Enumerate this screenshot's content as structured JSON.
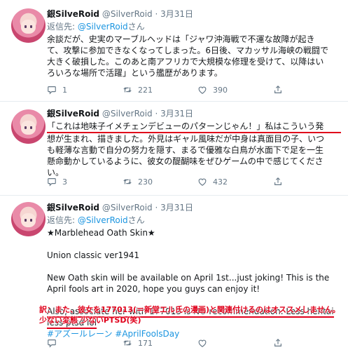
{
  "tweets": [
    {
      "name": "銀SilveRoid",
      "handle": "@SilverRoid",
      "dot": "·",
      "date": "3月31日",
      "replying_prefix": "返信先: ",
      "replying_to": "@SilverRoid",
      "replying_suffix": "さん",
      "lines": [
        "余談だが、史実のマーブルヘッドは「ジャワ沖海戦で不運な故障が起き",
        "て、攻撃に参加できなくなってしまった。6日後、マカッサル海峡の戦闘で",
        "大きく破損した。このあと南アフリカで大規模な修理を受けて、以降はい",
        "ろいろな場所で活躍」という艦歴があります。"
      ],
      "replies": "1",
      "retweets": "221",
      "likes": "390"
    },
    {
      "name": "銀SilveRoid",
      "handle": "@SilverRoid",
      "dot": "·",
      "date": "3月31日",
      "lines": [
        "「これは地味子イメチェンデビューのパターンじゃん！」私はこういう発",
        "想が生まれ、描きました。外見はギャル風味だが中身は真面目の子、いつ",
        "も軽薄な言動で自分の努力を隠す、まるで優雅な白鳥が水面下で足を一生",
        "懸命動かしているように、彼女の醍醐味をぜひゲームの中で感じてくださ",
        "い。"
      ],
      "replies": "3",
      "retweets": "230",
      "likes": "432"
    },
    {
      "name": "銀SilveRoid",
      "handle": "@SilverRoid",
      "dot": "·",
      "date": "3月31日",
      "replying_prefix": "返信先: ",
      "replying_to": "@SilverRoid",
      "replying_suffix": "さん",
      "title": "★Marblehead Oath Skin★",
      "subtitle": "Union classic ver1941",
      "para1": "New Oath skin will be available on April 1st...just joking! This is the April fools art in 2020, hope you guys can enjoy it!",
      "para2": "Also, associate her with 177013 is NO recommendation. Less hentai less ptsd lol",
      "hashtags": "#アズールレーン #AprilFoolsDay",
      "replies": "",
      "retweets": "171",
      "likes": ""
    }
  ],
  "annotation": {
    "line1": "訳：また、彼女を177013(＝新堂エル氏の漫画)と関連付けるのはオススメしません。",
    "line2": "少ない変態 少ないPTSD(笑)"
  }
}
